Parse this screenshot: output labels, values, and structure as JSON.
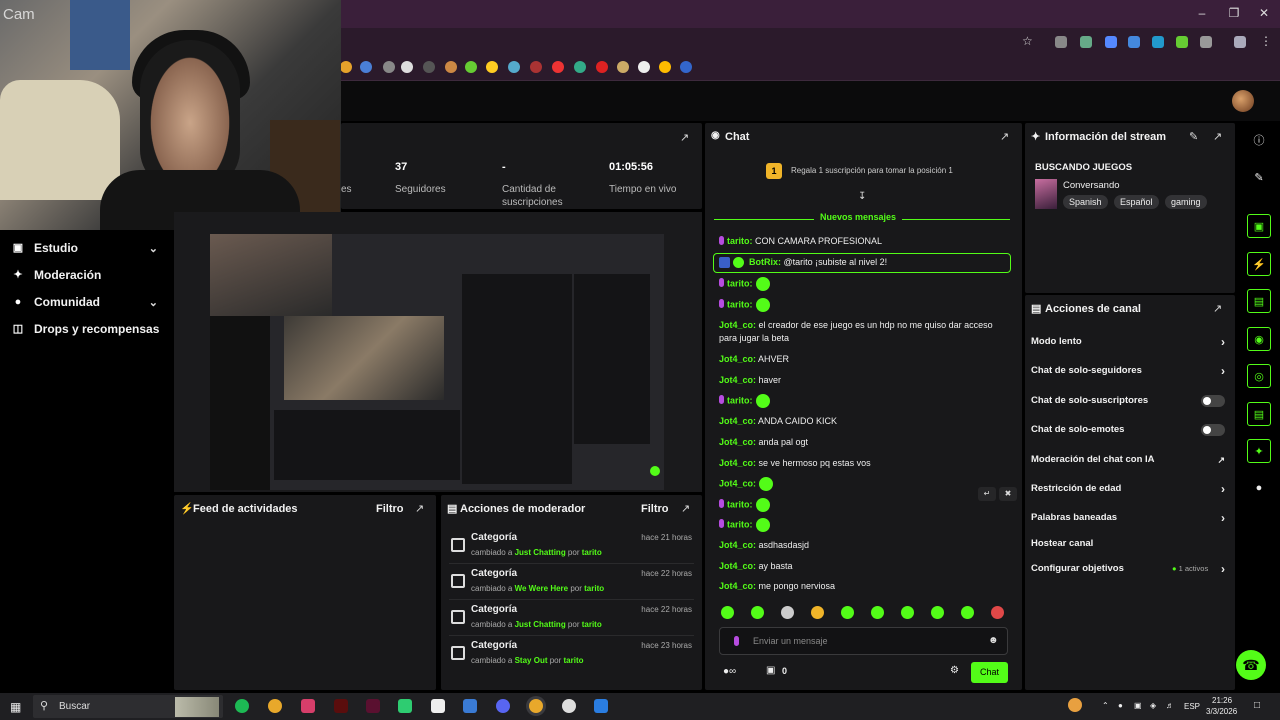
{
  "webcam": {
    "label": "Cam"
  },
  "sidebar": {
    "items": [
      {
        "label": "Estudio",
        "icon": "studio-icon"
      },
      {
        "label": "Moderación",
        "icon": "wrench-icon"
      },
      {
        "label": "Comunidad",
        "icon": "users-icon"
      },
      {
        "label": "Drops y recompensas",
        "icon": "gift-icon"
      }
    ]
  },
  "stats": {
    "partial_label": "es",
    "followers_value": "37",
    "followers_label": "Seguidores",
    "subs_value": "-",
    "subs_label": "Cantidad de suscripciones",
    "live_value": "01:05:56",
    "live_label": "Tiempo en vivo"
  },
  "feed": {
    "title": "Feed de actividades",
    "filter": "Filtro"
  },
  "modactions": {
    "title": "Acciones de moderador",
    "filter": "Filtro",
    "rows": [
      {
        "cat": "Categoría",
        "prefix": "cambiado a ",
        "value": "Just Chatting",
        "by": " por ",
        "user": "tarito",
        "time": "hace 21 horas"
      },
      {
        "cat": "Categoría",
        "prefix": "cambiado a ",
        "value": "We Were Here",
        "by": " por ",
        "user": "tarito",
        "time": "hace 22 horas"
      },
      {
        "cat": "Categoría",
        "prefix": "cambiado a ",
        "value": "Just Chatting",
        "by": " por ",
        "user": "tarito",
        "time": "hace 22 horas"
      },
      {
        "cat": "Categoría",
        "prefix": "cambiado a ",
        "value": "Stay Out",
        "by": " por ",
        "user": "tarito",
        "time": "hace 23 horas"
      }
    ]
  },
  "chat": {
    "title": "Chat",
    "gift_rank": "1",
    "gift_prompt": "Regala 1 suscripción para tomar la posición 1",
    "new_messages": "Nuevos mensajes",
    "botrix_user": "BotRix:",
    "botrix_msg": " @tarito ¡subiste al nivel 2!",
    "messages": [
      {
        "user": "tarito:",
        "text": " CON CAMARA PROFESIONAL",
        "mic": true,
        "emote": false
      },
      {
        "user": "tarito:",
        "text": "",
        "mic": true,
        "emote": true
      },
      {
        "user": "tarito:",
        "text": "",
        "mic": true,
        "emote": true
      },
      {
        "user": "Jot4_co:",
        "text": " el creador de ese juego es un hdp no me quiso dar acceso",
        "mic": false,
        "emote": false
      },
      {
        "user": "",
        "text": "para jugar la beta",
        "mic": false,
        "emote": false
      },
      {
        "user": "Jot4_co:",
        "text": " AHVER",
        "mic": false,
        "emote": false
      },
      {
        "user": "Jot4_co:",
        "text": " haver",
        "mic": false,
        "emote": false
      },
      {
        "user": "tarito:",
        "text": "",
        "mic": true,
        "emote": true
      },
      {
        "user": "Jot4_co:",
        "text": " ANDA CAIDO KICK",
        "mic": false,
        "emote": false
      },
      {
        "user": "Jot4_co:",
        "text": " anda pal ogt",
        "mic": false,
        "emote": false
      },
      {
        "user": "Jot4_co:",
        "text": " se ve hermoso pq estas vos",
        "mic": false,
        "emote": false
      },
      {
        "user": "Jot4_co:",
        "text": "",
        "mic": false,
        "emote": true
      },
      {
        "user": "tarito:",
        "text": "",
        "mic": true,
        "emote": true
      },
      {
        "user": "tarito:",
        "text": "",
        "mic": true,
        "emote": true
      },
      {
        "user": "Jot4_co:",
        "text": " asdhasdasjd",
        "mic": false,
        "emote": false
      },
      {
        "user": "Jot4_co:",
        "text": " ay basta",
        "mic": false,
        "emote": false
      },
      {
        "user": "Jot4_co:",
        "text": " me pongo nerviosa",
        "mic": false,
        "emote": false
      }
    ],
    "input_placeholder": "Enviar un mensaje",
    "points": "0",
    "send_label": "Chat"
  },
  "info": {
    "title": "Información del stream",
    "stream_title": "BUSCANDO JUEGOS",
    "category": "Conversando",
    "tags": [
      "Spanish",
      "Español",
      "gaming"
    ]
  },
  "actions": {
    "title": "Acciones de canal",
    "items": [
      {
        "label": "Modo lento",
        "kind": "chevron"
      },
      {
        "label": "Chat de solo-seguidores",
        "kind": "chevron"
      },
      {
        "label": "Chat de solo-suscriptores",
        "kind": "toggle"
      },
      {
        "label": "Chat de solo-emotes",
        "kind": "toggle"
      },
      {
        "label": "Moderación del chat con IA",
        "kind": "external"
      },
      {
        "label": "Restricción de edad",
        "kind": "chevron"
      },
      {
        "label": "Palabras baneadas",
        "kind": "chevron"
      },
      {
        "label": "Hostear canal",
        "kind": "none"
      },
      {
        "label": "Configurar objetivos",
        "kind": "chevron"
      }
    ],
    "objectives_badge": "1 activos"
  },
  "taskbar": {
    "search_placeholder": "Buscar",
    "lang": "ESP",
    "time": "21:26",
    "date": "3/3/2026"
  },
  "colors": {
    "accent": "#53fc18",
    "panel": "#18181a",
    "chrome": "#2b1a2b"
  }
}
